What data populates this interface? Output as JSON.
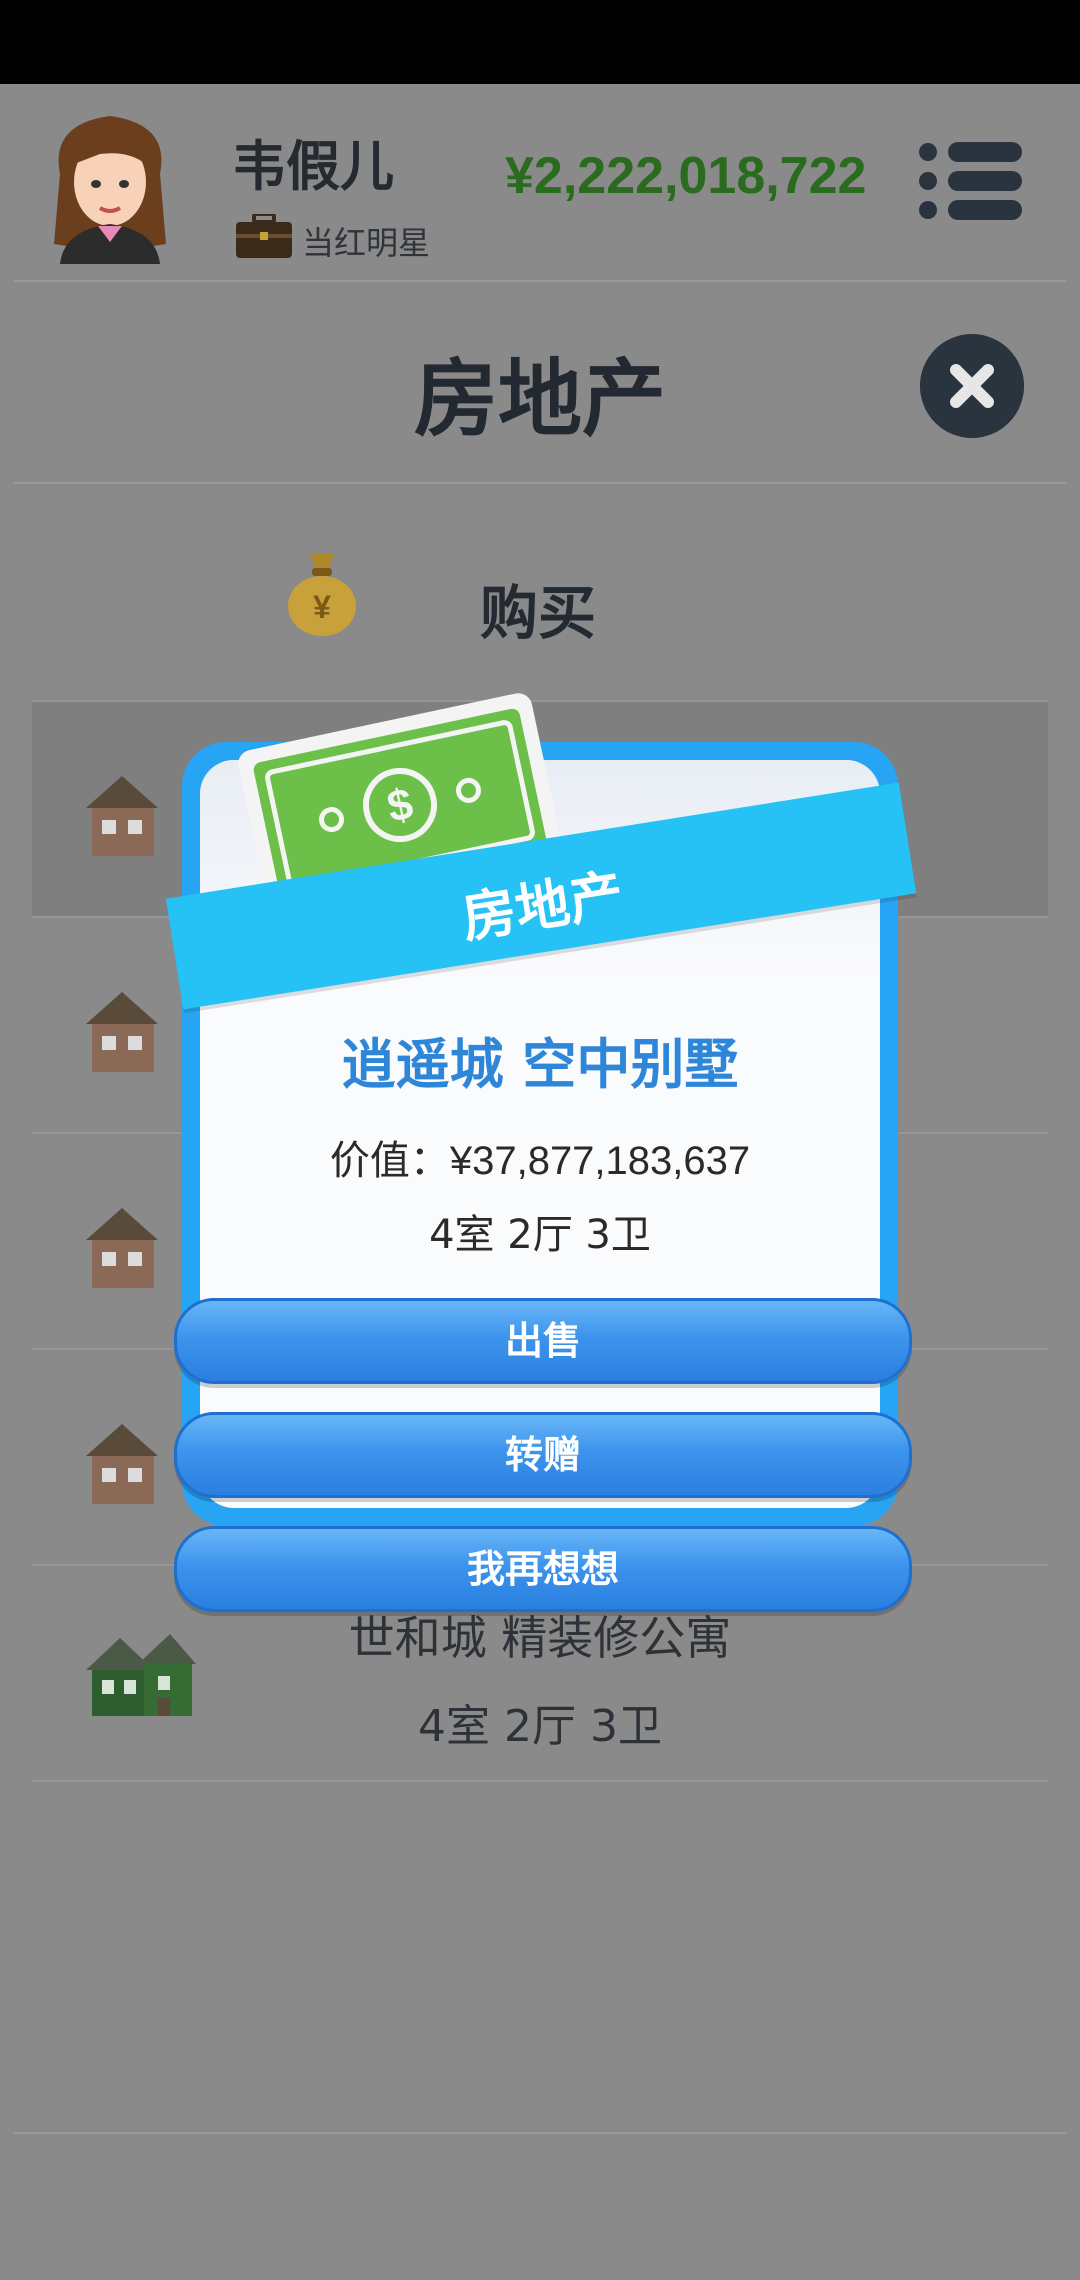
{
  "header": {
    "player_name": "韦假儿",
    "job_title": "当红明星",
    "money": "¥2,222,018,722"
  },
  "page": {
    "title": "房地产",
    "buy_label": "购买"
  },
  "properties": [
    {
      "name": "",
      "rooms": ""
    },
    {
      "name": "",
      "rooms": ""
    },
    {
      "name": "",
      "rooms": ""
    },
    {
      "name": "",
      "rooms": ""
    },
    {
      "name": "世和城 精装修公寓",
      "rooms": "4室 2厅 3卫"
    }
  ],
  "modal": {
    "title": "房地产",
    "property_name": "逍遥城 空中别墅",
    "value": "价值：¥37,877,183,637",
    "rooms": "4室 2厅 3卫",
    "buttons": {
      "sell": "出售",
      "gift": "转赠",
      "cancel": "我再想想"
    }
  },
  "colors": {
    "money": "#2a6b1f",
    "modal_name": "#2e86d8",
    "ribbon": "#26c2f5",
    "button": "#3d94ec",
    "overlay": "#8a8a8a"
  }
}
